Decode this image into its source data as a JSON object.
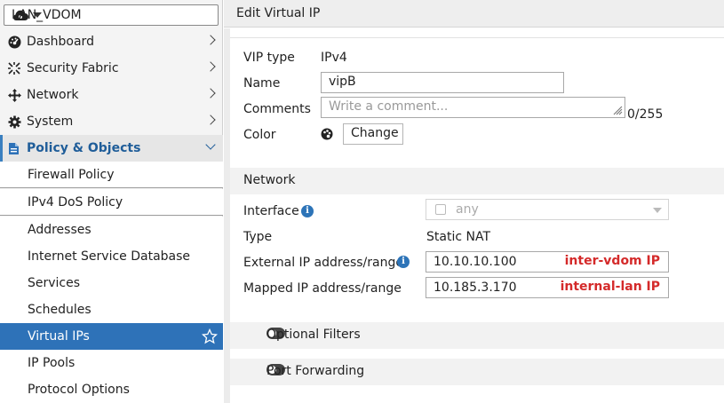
{
  "vdom": {
    "selected": "LAN_VDOM"
  },
  "sidebar": {
    "top_items": [
      {
        "label": "Dashboard",
        "icon": "dashboard-icon"
      },
      {
        "label": "Security Fabric",
        "icon": "security-fabric-icon"
      },
      {
        "label": "Network",
        "icon": "network-icon"
      },
      {
        "label": "System",
        "icon": "gear-icon"
      },
      {
        "label": "Policy & Objects",
        "icon": "policy-objects-icon"
      }
    ],
    "sub_items": [
      {
        "label": "Firewall Policy"
      },
      {
        "label": "IPv4 DoS Policy"
      },
      {
        "label": "Addresses"
      },
      {
        "label": "Internet Service Database"
      },
      {
        "label": "Services"
      },
      {
        "label": "Schedules"
      },
      {
        "label": "Virtual IPs"
      },
      {
        "label": "IP Pools"
      },
      {
        "label": "Protocol Options"
      }
    ]
  },
  "header": {
    "title": "Edit Virtual IP"
  },
  "form": {
    "vip_type_label": "VIP type",
    "vip_type_value": "IPv4",
    "name_label": "Name",
    "name_value": "vipB",
    "comments_label": "Comments",
    "comments_placeholder": "Write a comment...",
    "comments_counter": "0/255",
    "color_label": "Color",
    "color_button": "Change"
  },
  "network": {
    "section_title": "Network",
    "interface_label": "Interface",
    "interface_value": "any",
    "type_label": "Type",
    "type_value": "Static NAT",
    "external_label": "External IP address/range",
    "external_value": "10.10.10.100",
    "external_note": "inter-vdom IP",
    "mapped_label": "Mapped IP address/range",
    "mapped_value": "10.185.3.170",
    "mapped_note": "internal-lan IP"
  },
  "optional_filters": {
    "label": "Optional Filters",
    "enabled": false
  },
  "port_forwarding": {
    "label": "Port Forwarding",
    "enabled": false
  },
  "colors": {
    "accent": "#2e72b8",
    "annotation": "#d42a2a"
  }
}
